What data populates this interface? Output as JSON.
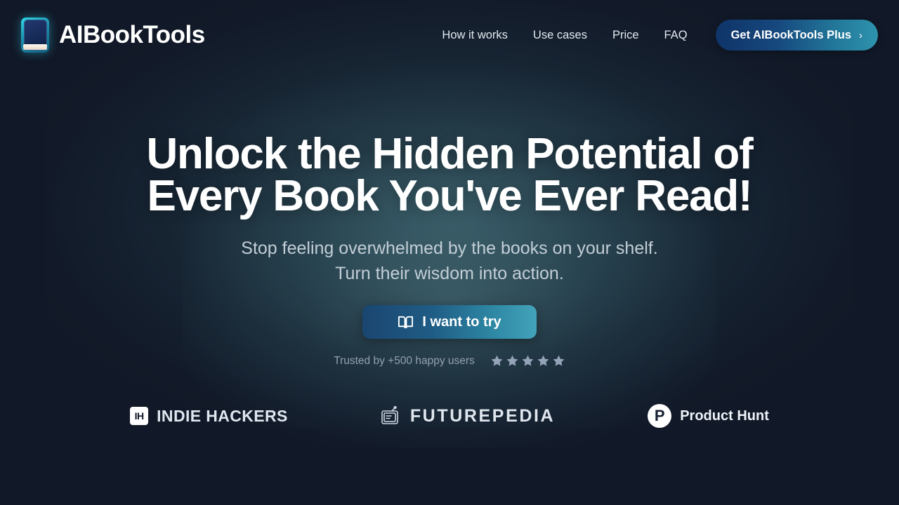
{
  "brand": {
    "name": "AIBookTools",
    "logo_icon": "book-icon"
  },
  "nav": {
    "links": [
      {
        "label": "How it works"
      },
      {
        "label": "Use cases"
      },
      {
        "label": "Price"
      },
      {
        "label": "FAQ"
      }
    ],
    "cta": {
      "label": "Get AIBookTools Plus",
      "chevron": "›"
    }
  },
  "hero": {
    "headline": "Unlock the Hidden Potential of Every Book You've Ever Read!",
    "subheadline": "Stop feeling overwhelmed by the books on your shelf. Turn their wisdom into action.",
    "cta_label": "I want to try",
    "cta_icon": "open-book-icon",
    "trust_text": "Trusted by +500 happy users",
    "star_count": 5,
    "star_color": "#94a3b8"
  },
  "logos": [
    {
      "name": "Indie Hackers",
      "badge": "IH",
      "text": "INDIE HACKERS"
    },
    {
      "name": "Futurepedia",
      "badge": "",
      "text": "FUTUREPEDIA"
    },
    {
      "name": "Product Hunt",
      "badge": "P",
      "text": "Product Hunt"
    }
  ],
  "colors": {
    "background": "#111827",
    "accent_teal": "#3a9cb5",
    "accent_blue": "#1c4a75",
    "text_primary": "#ffffff",
    "text_muted": "#c3ced6"
  }
}
